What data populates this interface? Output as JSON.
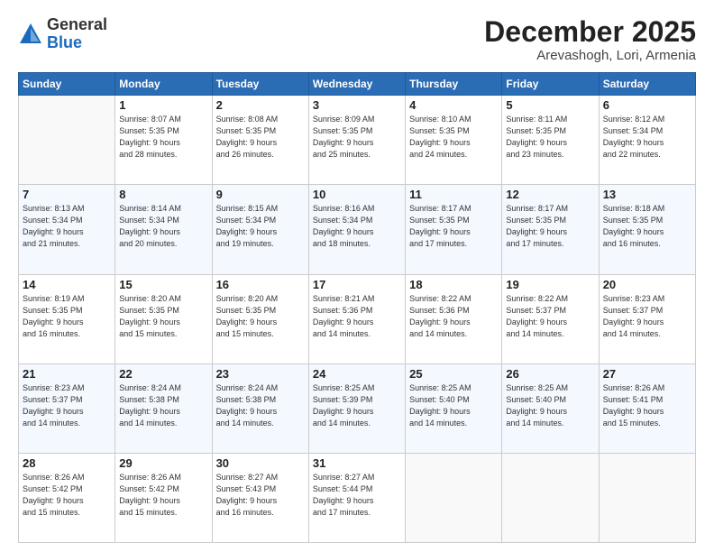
{
  "header": {
    "logo_general": "General",
    "logo_blue": "Blue",
    "month": "December 2025",
    "location": "Arevashogh, Lori, Armenia"
  },
  "weekdays": [
    "Sunday",
    "Monday",
    "Tuesday",
    "Wednesday",
    "Thursday",
    "Friday",
    "Saturday"
  ],
  "weeks": [
    [
      {
        "day": "",
        "empty": true
      },
      {
        "day": "1",
        "sunrise": "8:07 AM",
        "sunset": "5:35 PM",
        "daylight": "9 hours and 28 minutes."
      },
      {
        "day": "2",
        "sunrise": "8:08 AM",
        "sunset": "5:35 PM",
        "daylight": "9 hours and 26 minutes."
      },
      {
        "day": "3",
        "sunrise": "8:09 AM",
        "sunset": "5:35 PM",
        "daylight": "9 hours and 25 minutes."
      },
      {
        "day": "4",
        "sunrise": "8:10 AM",
        "sunset": "5:35 PM",
        "daylight": "9 hours and 24 minutes."
      },
      {
        "day": "5",
        "sunrise": "8:11 AM",
        "sunset": "5:35 PM",
        "daylight": "9 hours and 23 minutes."
      },
      {
        "day": "6",
        "sunrise": "8:12 AM",
        "sunset": "5:34 PM",
        "daylight": "9 hours and 22 minutes."
      }
    ],
    [
      {
        "day": "7",
        "sunrise": "8:13 AM",
        "sunset": "5:34 PM",
        "daylight": "9 hours and 21 minutes."
      },
      {
        "day": "8",
        "sunrise": "8:14 AM",
        "sunset": "5:34 PM",
        "daylight": "9 hours and 20 minutes."
      },
      {
        "day": "9",
        "sunrise": "8:15 AM",
        "sunset": "5:34 PM",
        "daylight": "9 hours and 19 minutes."
      },
      {
        "day": "10",
        "sunrise": "8:16 AM",
        "sunset": "5:34 PM",
        "daylight": "9 hours and 18 minutes."
      },
      {
        "day": "11",
        "sunrise": "8:17 AM",
        "sunset": "5:35 PM",
        "daylight": "9 hours and 17 minutes."
      },
      {
        "day": "12",
        "sunrise": "8:17 AM",
        "sunset": "5:35 PM",
        "daylight": "9 hours and 17 minutes."
      },
      {
        "day": "13",
        "sunrise": "8:18 AM",
        "sunset": "5:35 PM",
        "daylight": "9 hours and 16 minutes."
      }
    ],
    [
      {
        "day": "14",
        "sunrise": "8:19 AM",
        "sunset": "5:35 PM",
        "daylight": "9 hours and 16 minutes."
      },
      {
        "day": "15",
        "sunrise": "8:20 AM",
        "sunset": "5:35 PM",
        "daylight": "9 hours and 15 minutes."
      },
      {
        "day": "16",
        "sunrise": "8:20 AM",
        "sunset": "5:35 PM",
        "daylight": "9 hours and 15 minutes."
      },
      {
        "day": "17",
        "sunrise": "8:21 AM",
        "sunset": "5:36 PM",
        "daylight": "9 hours and 14 minutes."
      },
      {
        "day": "18",
        "sunrise": "8:22 AM",
        "sunset": "5:36 PM",
        "daylight": "9 hours and 14 minutes."
      },
      {
        "day": "19",
        "sunrise": "8:22 AM",
        "sunset": "5:37 PM",
        "daylight": "9 hours and 14 minutes."
      },
      {
        "day": "20",
        "sunrise": "8:23 AM",
        "sunset": "5:37 PM",
        "daylight": "9 hours and 14 minutes."
      }
    ],
    [
      {
        "day": "21",
        "sunrise": "8:23 AM",
        "sunset": "5:37 PM",
        "daylight": "9 hours and 14 minutes."
      },
      {
        "day": "22",
        "sunrise": "8:24 AM",
        "sunset": "5:38 PM",
        "daylight": "9 hours and 14 minutes."
      },
      {
        "day": "23",
        "sunrise": "8:24 AM",
        "sunset": "5:38 PM",
        "daylight": "9 hours and 14 minutes."
      },
      {
        "day": "24",
        "sunrise": "8:25 AM",
        "sunset": "5:39 PM",
        "daylight": "9 hours and 14 minutes."
      },
      {
        "day": "25",
        "sunrise": "8:25 AM",
        "sunset": "5:40 PM",
        "daylight": "9 hours and 14 minutes."
      },
      {
        "day": "26",
        "sunrise": "8:25 AM",
        "sunset": "5:40 PM",
        "daylight": "9 hours and 14 minutes."
      },
      {
        "day": "27",
        "sunrise": "8:26 AM",
        "sunset": "5:41 PM",
        "daylight": "9 hours and 15 minutes."
      }
    ],
    [
      {
        "day": "28",
        "sunrise": "8:26 AM",
        "sunset": "5:42 PM",
        "daylight": "9 hours and 15 minutes."
      },
      {
        "day": "29",
        "sunrise": "8:26 AM",
        "sunset": "5:42 PM",
        "daylight": "9 hours and 15 minutes."
      },
      {
        "day": "30",
        "sunrise": "8:27 AM",
        "sunset": "5:43 PM",
        "daylight": "9 hours and 16 minutes."
      },
      {
        "day": "31",
        "sunrise": "8:27 AM",
        "sunset": "5:44 PM",
        "daylight": "9 hours and 17 minutes."
      },
      {
        "day": "",
        "empty": true
      },
      {
        "day": "",
        "empty": true
      },
      {
        "day": "",
        "empty": true
      }
    ]
  ]
}
